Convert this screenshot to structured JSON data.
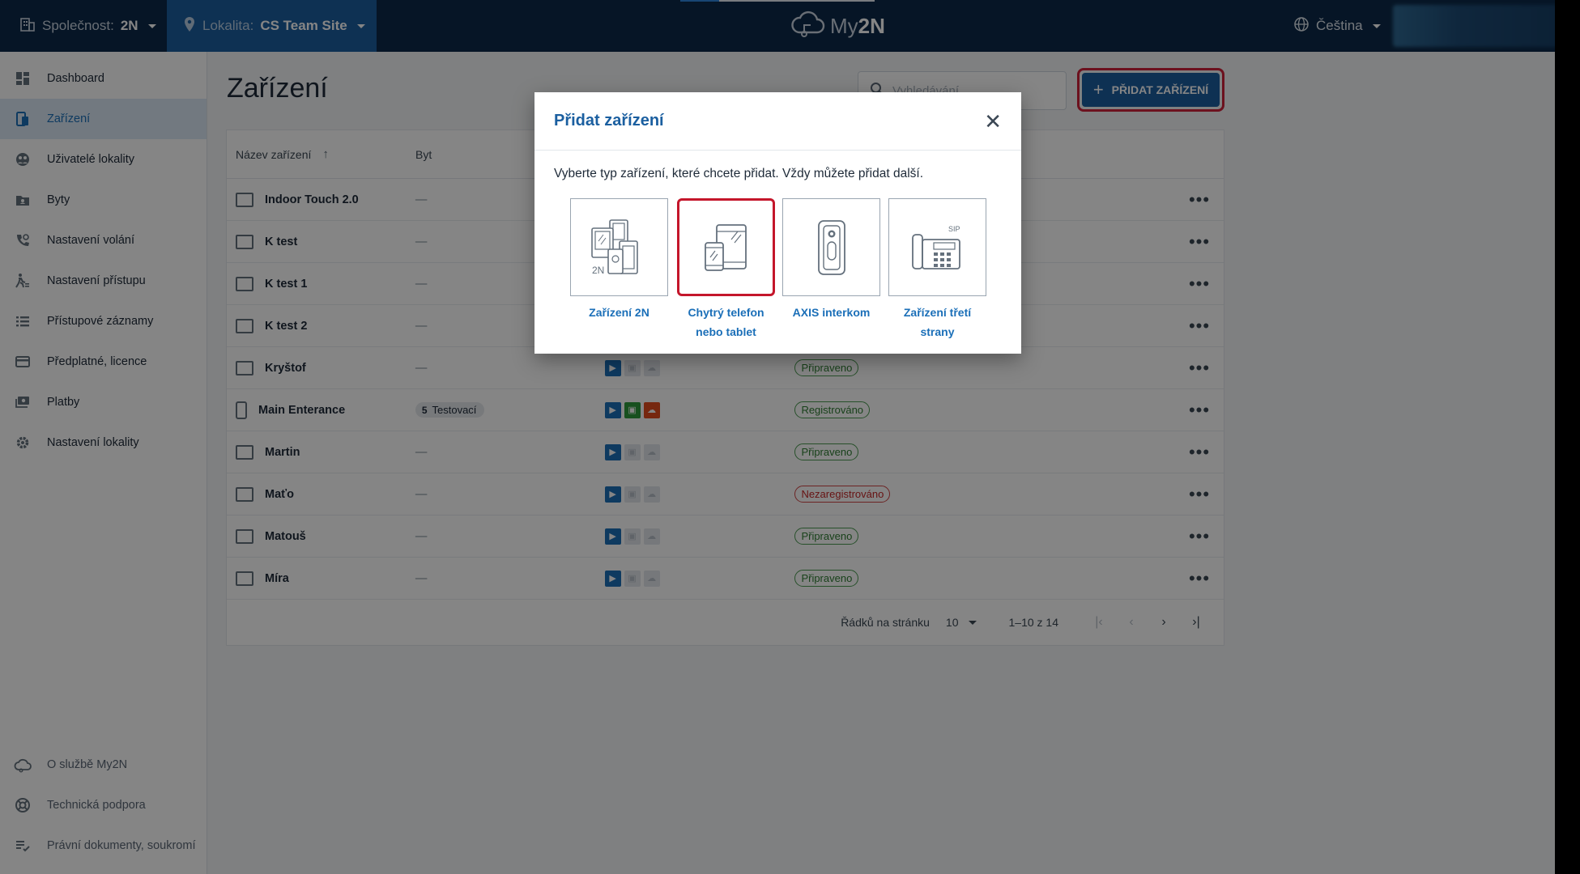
{
  "topbar": {
    "company_label": "Společnost:",
    "company_value": "2N",
    "site_label": "Lokalita:",
    "site_value": "CS Team Site",
    "logo_text_a": "My",
    "logo_text_b": "2N",
    "language": "Čeština"
  },
  "sidebar": {
    "items": [
      {
        "label": "Dashboard",
        "icon": "dashboard-icon"
      },
      {
        "label": "Zařízení",
        "icon": "device-icon"
      },
      {
        "label": "Uživatelé lokality",
        "icon": "users-icon"
      },
      {
        "label": "Byty",
        "icon": "apartment-icon"
      },
      {
        "label": "Nastavení volání",
        "icon": "call-settings-icon"
      },
      {
        "label": "Nastavení přístupu",
        "icon": "access-icon"
      },
      {
        "label": "Přístupové záznamy",
        "icon": "access-log-icon"
      },
      {
        "label": "Předplatné, licence",
        "icon": "card-icon"
      },
      {
        "label": "Platby",
        "icon": "payments-icon"
      },
      {
        "label": "Nastavení lokality",
        "icon": "gear-icon"
      }
    ],
    "bottom": [
      {
        "label": "O službě My2N",
        "icon": "cloud-icon"
      },
      {
        "label": "Technická podpora",
        "icon": "lifebuoy-icon"
      },
      {
        "label": "Právní dokumenty, soukromí",
        "icon": "list-check-icon"
      }
    ]
  },
  "main": {
    "title": "Zařízení",
    "search_placeholder": "Vyhledávání",
    "add_button": "PŘIDAT ZAŘÍZENÍ",
    "columns": {
      "name": "Název zařízení",
      "byt": "Byt"
    },
    "rows": [
      {
        "name": "Indoor Touch 2.0",
        "byt": "—",
        "status": ""
      },
      {
        "name": "K test",
        "byt": "—",
        "status": ""
      },
      {
        "name": "K test 1",
        "byt": "—",
        "status": ""
      },
      {
        "name": "K test 2",
        "byt": "—",
        "status": ""
      },
      {
        "name": "Kryštof",
        "byt": "—",
        "status": "Připraveno"
      },
      {
        "name": "Main Enterance",
        "byt_chip_num": "5",
        "byt_chip_text": "Testovací",
        "status": "Registrováno"
      },
      {
        "name": "Martin",
        "byt": "—",
        "status": "Připraveno"
      },
      {
        "name": "Maťo",
        "byt": "—",
        "status": "Nezaregistrováno"
      },
      {
        "name": "Matouš",
        "byt": "—",
        "status": "Připraveno"
      },
      {
        "name": "Míra",
        "byt": "—",
        "status": "Připraveno"
      }
    ],
    "pager": {
      "rows_label": "Řádků na stránku",
      "rows_value": "10",
      "range": "1–10 z 14"
    }
  },
  "modal": {
    "title": "Přidat zařízení",
    "description": "Vyberte typ zařízení, které chcete přidat. Vždy můžete přidat další.",
    "tiles": [
      {
        "line1": "Zařízení 2N",
        "line2": ""
      },
      {
        "line1": "Chytrý telefon",
        "line2": "nebo tablet"
      },
      {
        "line1": "AXIS interkom",
        "line2": ""
      },
      {
        "line1": "Zařízení třetí",
        "line2": "strany"
      }
    ],
    "tile_text_2n": "2N",
    "tile_text_sip": "SIP"
  }
}
